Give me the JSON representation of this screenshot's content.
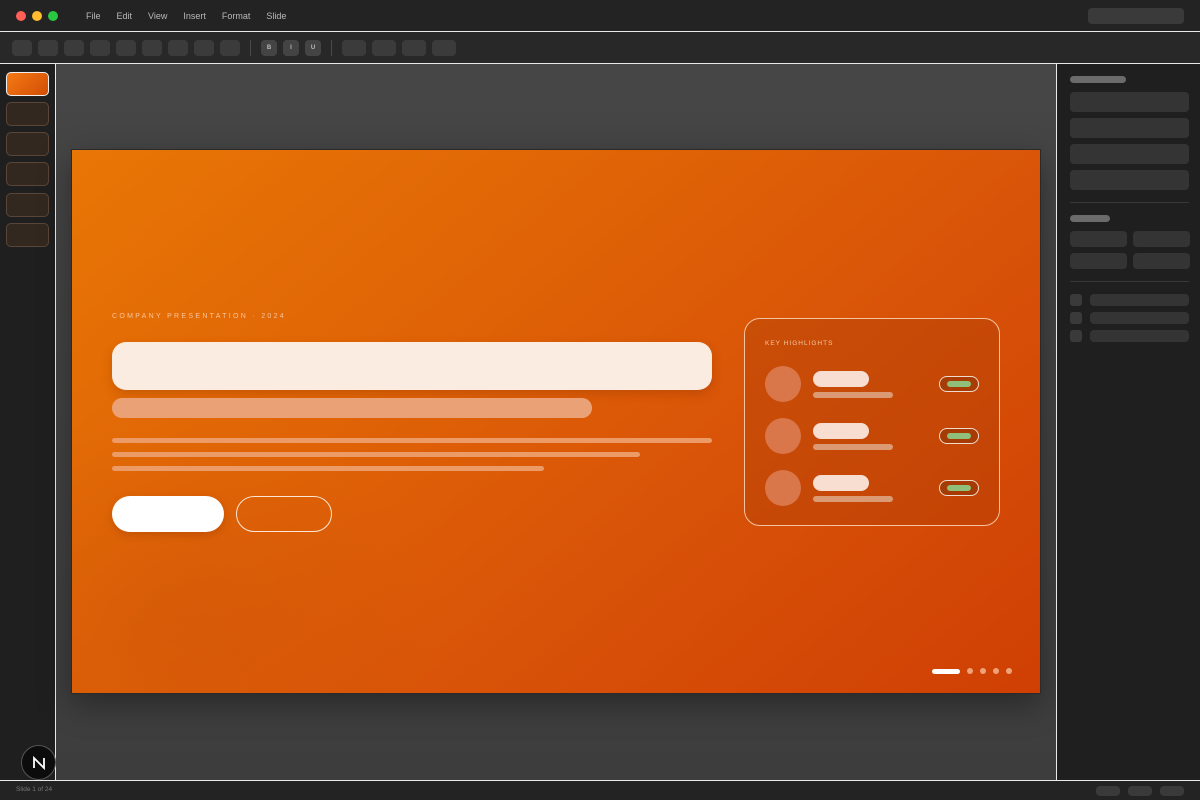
{
  "menu": {
    "items": [
      {
        "label": "File"
      },
      {
        "label": "Edit"
      },
      {
        "label": "View"
      },
      {
        "label": "Insert"
      },
      {
        "label": "Format"
      },
      {
        "label": "Slide"
      }
    ]
  },
  "toolbar": {
    "format_buttons": [
      {
        "label": "B",
        "icon": "bold-icon"
      },
      {
        "label": "I",
        "icon": "italic-icon"
      },
      {
        "label": "U",
        "icon": "underline-icon"
      }
    ]
  },
  "slides": {
    "count_visible": 6,
    "active_index": 0
  },
  "slide": {
    "eyebrow": "COMPANY PRESENTATION · 2024",
    "highlights": {
      "title": "KEY HIGHLIGHTS",
      "rows": 3
    },
    "pagination": {
      "total": 5,
      "active_index": 0
    }
  },
  "status": {
    "text": "Slide 1 of 24"
  },
  "colors": {
    "accent_orange": "#e06406",
    "traffic_close": "#ff5f57",
    "traffic_minimize": "#febc2e",
    "traffic_maximize": "#28c840",
    "badge_green": "#8fbf78"
  }
}
